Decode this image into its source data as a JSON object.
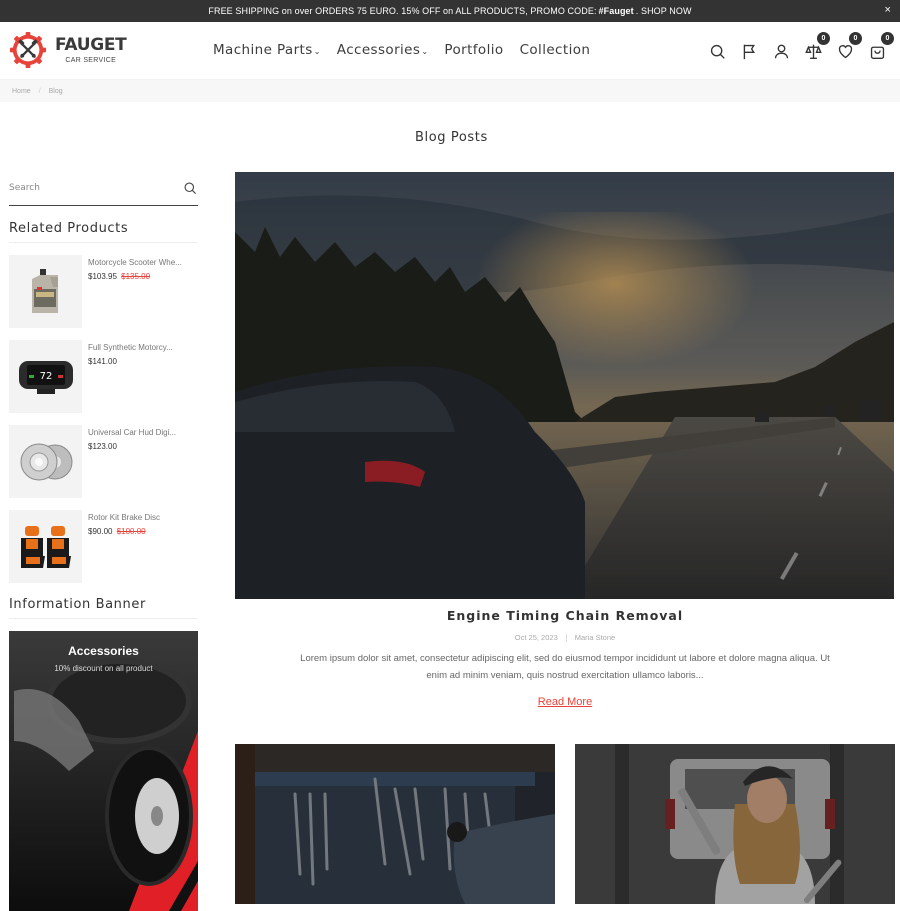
{
  "announcement": {
    "text_before": "FREE SHIPPING on over ORDERS 75 EURO. 15% OFF on ALL PRODUCTS, PROMO CODE: ",
    "promo_code": "#Fauget",
    "text_after": ". SHOP NOW",
    "close_label": "×"
  },
  "brand": {
    "name": "FAUGET",
    "tagline": "CAR SERVICE",
    "accent": "#e8433a"
  },
  "nav": {
    "items": [
      {
        "label": "Machine Parts",
        "has_dropdown": true
      },
      {
        "label": "Accessories",
        "has_dropdown": true
      },
      {
        "label": "Portfolio",
        "has_dropdown": false
      },
      {
        "label": "Collection",
        "has_dropdown": false
      }
    ],
    "chevron": "⌄"
  },
  "header_icons": {
    "search": "search-icon",
    "flag": "flag-icon",
    "account": "user-icon",
    "compare": {
      "icon": "scale-icon",
      "count": "0"
    },
    "wishlist": {
      "icon": "heart-icon",
      "count": "0"
    },
    "cart": {
      "icon": "bag-icon",
      "count": "0"
    }
  },
  "breadcrumb": {
    "items": [
      "Home",
      "Blog"
    ],
    "separator": "/"
  },
  "page": {
    "title": "Blog Posts"
  },
  "sidebar": {
    "search_placeholder": "Search",
    "related_heading": "Related Products",
    "products": [
      {
        "name": "Motorcycle Scooter Whe...",
        "price": "$103.95",
        "old_price": "$135.00",
        "image": "oil-canister"
      },
      {
        "name": "Full Synthetic Motorcy...",
        "price": "$141.00",
        "old_price": "",
        "image": "hud-display",
        "display_value": "72"
      },
      {
        "name": "Universal Car Hud Digi...",
        "price": "$123.00",
        "old_price": "",
        "image": "brake-discs"
      },
      {
        "name": "Rotor Kit Brake Disc",
        "price": "$90.00",
        "old_price": "$100.00",
        "image": "car-seats"
      }
    ],
    "banner_heading": "Information Banner",
    "banner": {
      "title": "Accessories",
      "subtitle": "10% discount on all product"
    }
  },
  "featured_post": {
    "title": "Engine Timing Chain Removal",
    "date": "Oct 25, 2023",
    "author": "Maria Stone",
    "excerpt": "Lorem ipsum dolor sit amet, consectetur adipiscing elit, sed do eiusmod tempor incididunt ut labore et dolore magna aliqua. Ut enim ad minim veniam, quis nostrud exercitation ullamco laboris...",
    "read_more": "Read More",
    "image": "car-on-highway-sunset"
  },
  "posts": [
    {
      "image": "mechanic-tool-wall"
    },
    {
      "image": "woman-mechanic-wrenches"
    }
  ]
}
